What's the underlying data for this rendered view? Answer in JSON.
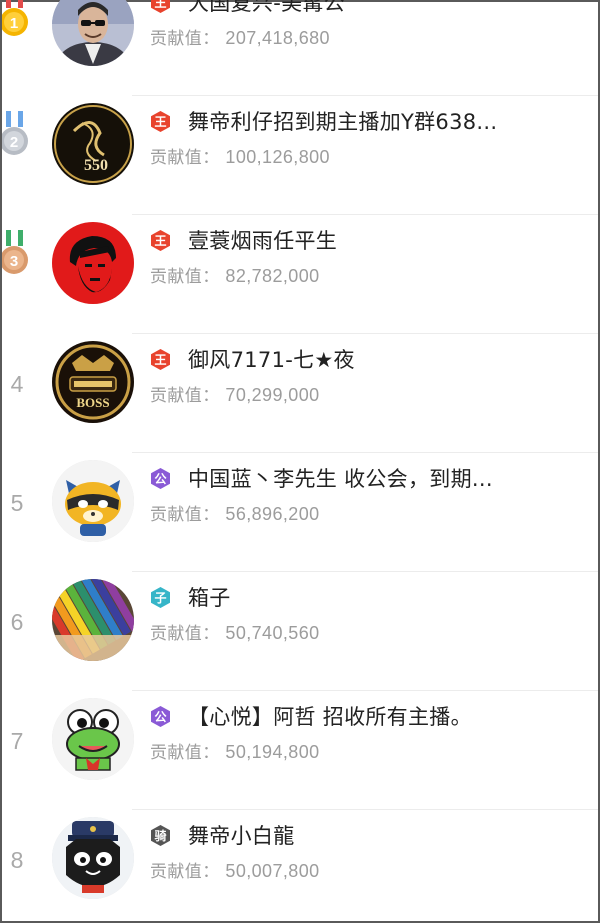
{
  "contribution_label": "贡献值：",
  "colors": {
    "gold": "#f5b400",
    "silver": "#b7bcc4",
    "bronze": "#d99a6c",
    "badge_red": "#e8432d",
    "badge_purple": "#8a5ad6",
    "badge_teal": "#36b5c8",
    "badge_dark": "#555555"
  },
  "rows": [
    {
      "rank": "1",
      "medal": "gold",
      "badge_icon": "crown-badge-icon",
      "badge_text": "王",
      "name": "大国复兴-美髯公",
      "contribution": "207,418,680"
    },
    {
      "rank": "2",
      "medal": "silver",
      "badge_icon": "crown-badge-icon",
      "badge_text": "王",
      "name": "舞帝利仔招到期主播加Y群638...",
      "contribution": "100,126,800",
      "avatar_text": "550"
    },
    {
      "rank": "3",
      "medal": "bronze",
      "badge_icon": "crown-badge-icon",
      "badge_text": "王",
      "name": "壹蓑烟雨任平生",
      "contribution": "82,782,000"
    },
    {
      "rank": "4",
      "medal": "",
      "badge_icon": "crown-badge-icon",
      "badge_text": "王",
      "name": "御风7171-七★夜",
      "contribution": "70,299,000",
      "avatar_text": "BOSS"
    },
    {
      "rank": "5",
      "medal": "",
      "badge_icon": "duke-badge-icon",
      "badge_text": "公",
      "name": "中国蓝丶李先生  收公会，到期...",
      "contribution": "56,896,200"
    },
    {
      "rank": "6",
      "medal": "",
      "badge_icon": "viscount-badge-icon",
      "badge_text": "子",
      "name": "箱子",
      "contribution": "50,740,560"
    },
    {
      "rank": "7",
      "medal": "",
      "badge_icon": "duke-badge-icon",
      "badge_text": "公",
      "name": "【心悦】阿哲  招收所有主播。",
      "contribution": "50,194,800"
    },
    {
      "rank": "8",
      "medal": "",
      "badge_icon": "knight-badge-icon",
      "badge_text": "骑",
      "name": "舞帝小白龍",
      "contribution": "50,007,800"
    }
  ]
}
